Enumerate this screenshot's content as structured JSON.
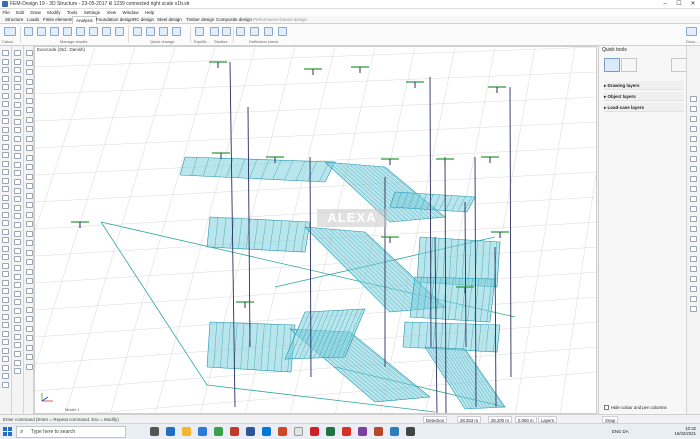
{
  "window": {
    "title": "FEM-Design 19 - 3D Structure - 23-05-2017 kl 1239 connected right scale v1b.str",
    "controls": [
      "–",
      "☐",
      "✕"
    ]
  },
  "menu": [
    "File",
    "Edit",
    "Draw",
    "Modify",
    "Tools",
    "Settings",
    "View",
    "Window",
    "Help"
  ],
  "tabs": [
    "Structure",
    "Loads",
    "Finite elements",
    "Analysis",
    "Foundation design",
    "RC design",
    "Steel design",
    "Timber design",
    "Composite design",
    "Performance-based design"
  ],
  "active_tab": "Analysis",
  "ribbon_groups": [
    "Calcul.",
    "Manage results",
    "Quick change",
    "Equilib...",
    "Studies",
    "Deflection check",
    "Docu..."
  ],
  "canvas": {
    "standard_label": "Eurocode (Std.: Danish)",
    "watermark": "ALEXA",
    "axis_label": "Model 1"
  },
  "quick_tools": {
    "header": "Quick tools",
    "layers": [
      "Drawing layers",
      "Object layers",
      "Load-case layers"
    ],
    "hide_option": "Hide colour and pen columns"
  },
  "command_bar": {
    "prompt": "Enter command (Enter = Repeat command, Esc = Modify)",
    "status": [
      "Detection",
      "28.253 m",
      "25.200 m",
      "0.000 m",
      "Layers",
      "Snap"
    ]
  },
  "taskbar": {
    "search_placeholder": "Type here to search",
    "time": "10:32",
    "date": "16/02/2021",
    "lang": "ENG DA"
  },
  "colors": {
    "slab": "#7fd0dc",
    "slab_line": "#1d95ad",
    "column": "#2b2f60",
    "brace": "#2fa89a",
    "support": "#2e9a3c",
    "grid": "#d9d9d9"
  }
}
